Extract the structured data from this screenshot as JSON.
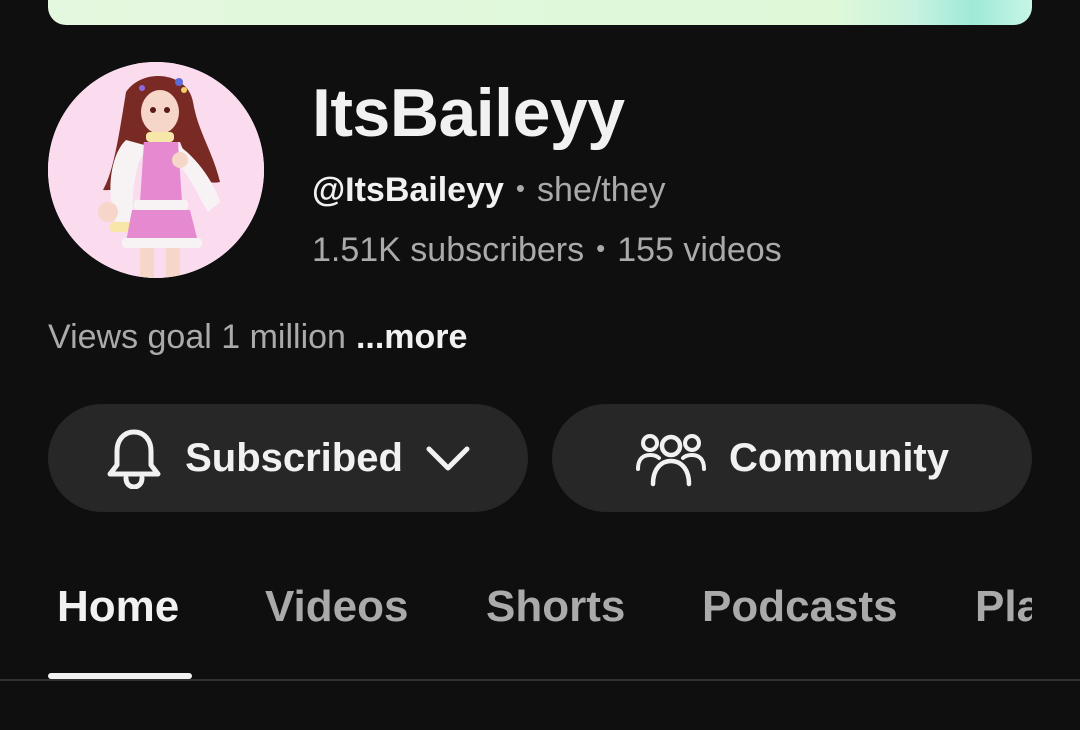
{
  "channel": {
    "name": "ItsBaileyy",
    "handle": "@ItsBaileyy",
    "pronouns": "she/they",
    "subscribers": "1.51K subscribers",
    "videos": "155 videos",
    "description": "Views goal 1 million",
    "more_label": "...more"
  },
  "separator": "•",
  "buttons": {
    "subscribed_label": "Subscribed",
    "community_label": "Community"
  },
  "tabs": [
    {
      "label": "Home",
      "active": true
    },
    {
      "label": "Videos",
      "active": false
    },
    {
      "label": "Shorts",
      "active": false
    },
    {
      "label": "Podcasts",
      "active": false
    },
    {
      "label": "Pla",
      "active": false
    }
  ],
  "icons": {
    "subscribed": "bell-icon",
    "dropdown": "chevron-down-icon",
    "community": "people-group-icon"
  },
  "colors": {
    "background": "#0f0f0f",
    "button_bg": "#272727",
    "text_primary": "#f1f1f1",
    "text_secondary": "#aaaaaa",
    "banner": "#def8d8"
  }
}
